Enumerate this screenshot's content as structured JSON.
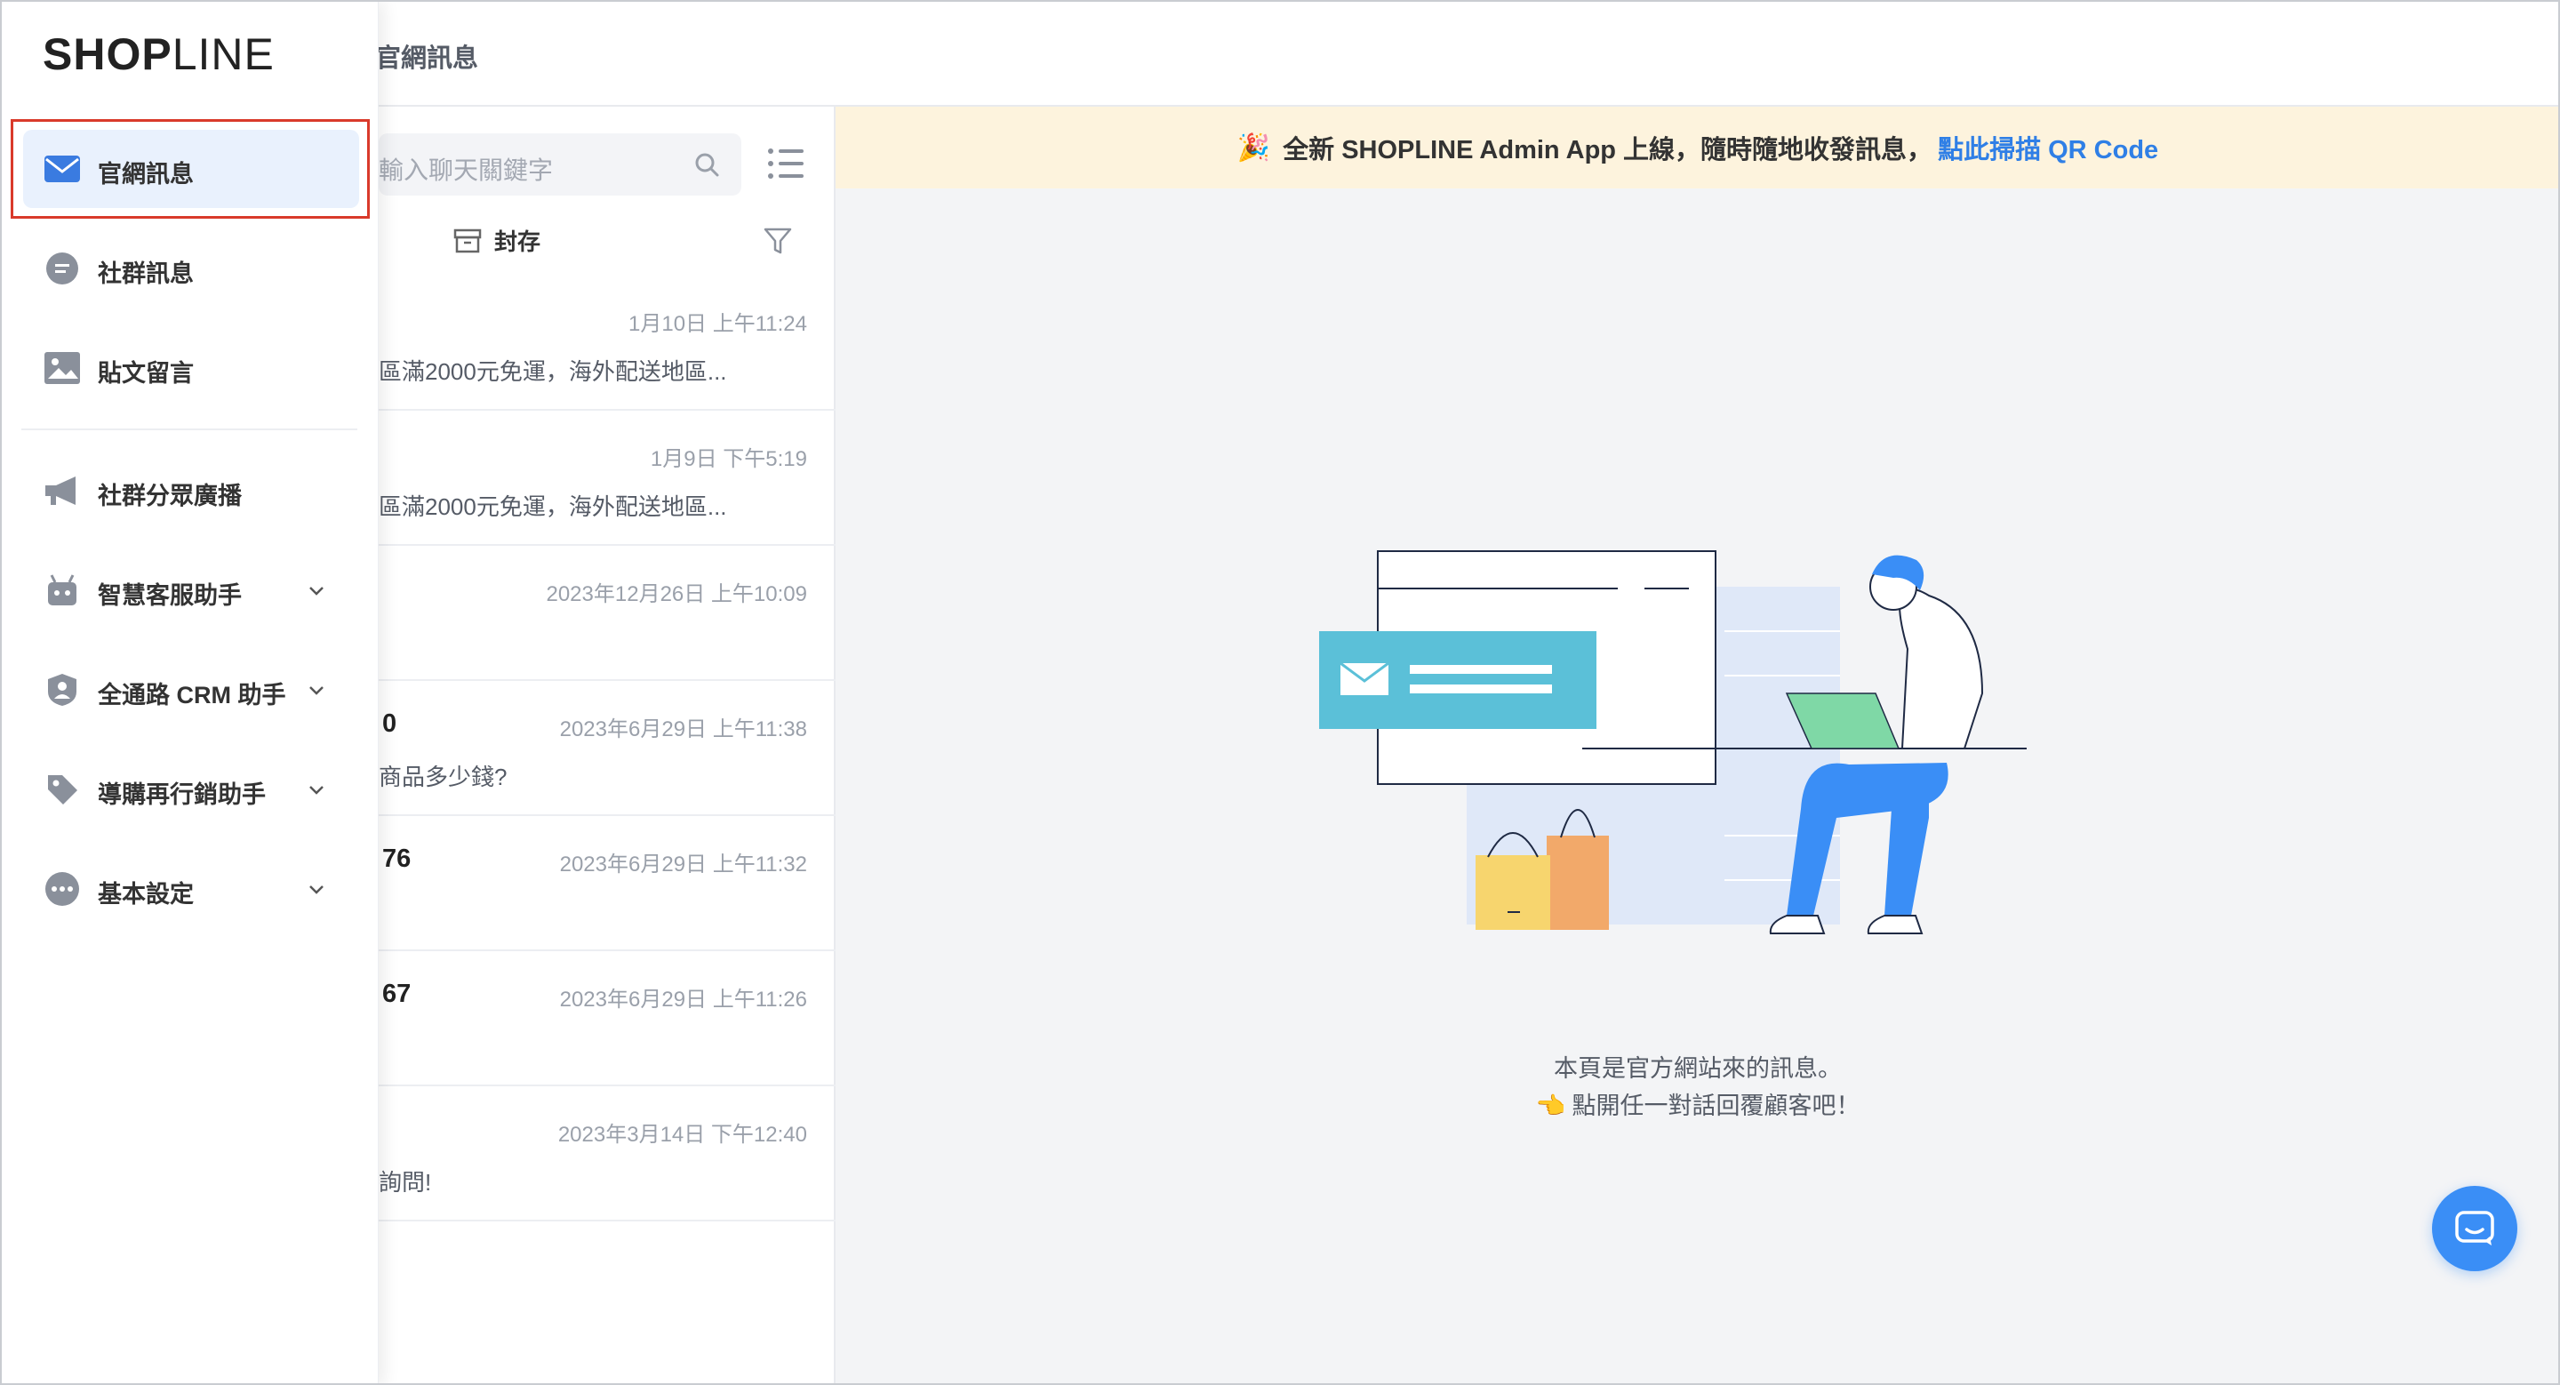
{
  "header": {
    "breadcrumb": "官網訊息"
  },
  "logo": {
    "bold": "SHOP",
    "light": "LINE"
  },
  "sidebar": {
    "items": [
      {
        "label": "官網訊息",
        "icon": "envelope-icon",
        "active": true
      },
      {
        "label": "社群訊息",
        "icon": "chat-bubble-icon"
      },
      {
        "label": "貼文留言",
        "icon": "image-post-icon"
      },
      {
        "label": "社群分眾廣播",
        "icon": "megaphone-icon"
      },
      {
        "label": "智慧客服助手",
        "icon": "robot-icon",
        "expandable": true
      },
      {
        "label": "全通路 CRM 助手",
        "icon": "crm-person-icon",
        "expandable": true
      },
      {
        "label": "導購再行銷助手",
        "icon": "tag-icon",
        "expandable": true
      },
      {
        "label": "基本設定",
        "icon": "more-dots-icon",
        "expandable": true
      }
    ]
  },
  "list": {
    "search_placeholder": "輸入聊天關鍵字",
    "archive_label": "封存",
    "conversations": [
      {
        "name": "",
        "time": "1月10日 上午11:24",
        "preview": "區滿2000元免運，海外配送地區..."
      },
      {
        "name": "",
        "time": "1月9日 下午5:19",
        "preview": "區滿2000元免運，海外配送地區..."
      },
      {
        "name": "",
        "time": "2023年12月26日 上午10:09",
        "preview": ""
      },
      {
        "name": "0",
        "time": "2023年6月29日 上午11:38",
        "preview": "商品多少錢?"
      },
      {
        "name": "76",
        "time": "2023年6月29日 上午11:32",
        "preview": ""
      },
      {
        "name": "67",
        "time": "2023年6月29日 上午11:26",
        "preview": ""
      },
      {
        "name": "",
        "time": "2023年3月14日 下午12:40",
        "preview": "詢問!"
      }
    ]
  },
  "banner": {
    "icon": "party-popper-icon",
    "text": "全新 SHOPLINE Admin App 上線，隨時隨地收發訊息，",
    "link": "點此掃描 QR Code"
  },
  "empty_state": {
    "line1": "本頁是官方網站來的訊息。",
    "line2": "👈 點開任一對話回覆顧客吧！"
  },
  "colors": {
    "accent": "#2f7fe6",
    "active_bg": "#e9f1fd",
    "banner_bg": "#fdf3dd",
    "highlight": "#d93a2b",
    "fab": "#3a8ef6"
  }
}
